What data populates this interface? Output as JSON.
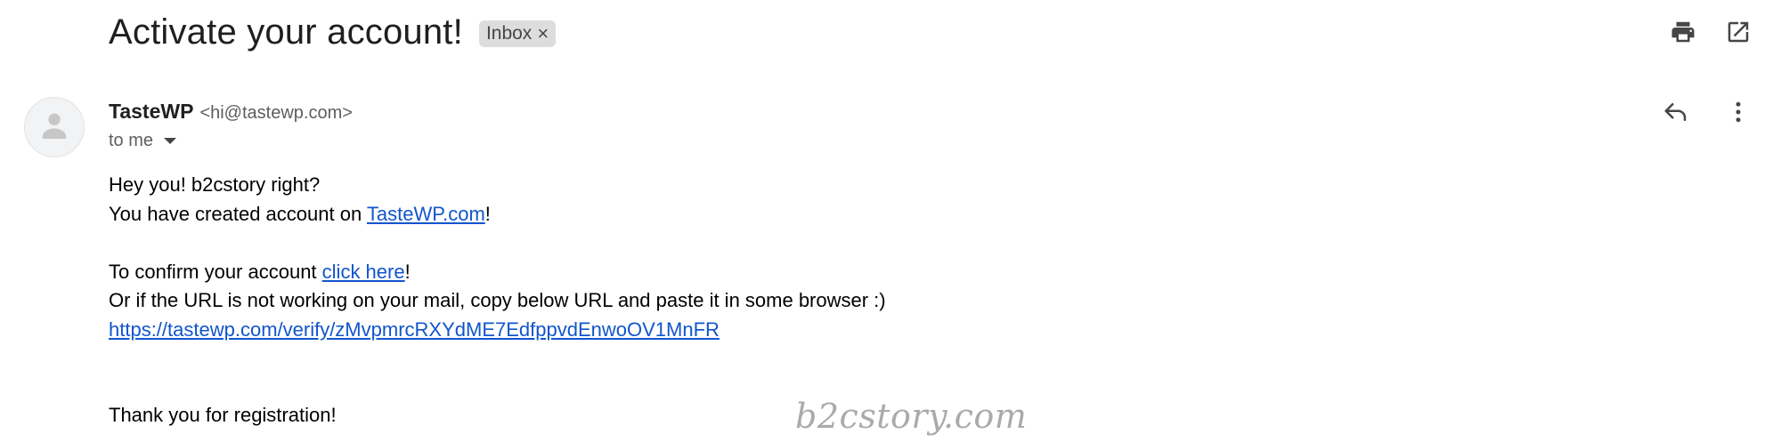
{
  "email": {
    "subject": "Activate your account!",
    "label": "Inbox",
    "label_remove": "×",
    "sender_name": "TasteWP",
    "sender_email": "<hi@tastewp.com>",
    "recipient": "to me"
  },
  "toolbar": {
    "print_icon": "print-icon",
    "popout_icon": "open-in-new-window-icon",
    "reply_icon": "reply-icon",
    "more_icon": "more-vertical-icon"
  },
  "message": {
    "greeting": "Hey you! b2cstory right?",
    "created_prefix": "You have created account on ",
    "created_link": "TasteWP.com",
    "created_suffix": "!",
    "confirm_prefix": "To confirm your account ",
    "confirm_link": "click here",
    "confirm_suffix": "!",
    "fallback_text": "Or if the URL is not working on your mail, copy below URL and paste it in some browser :)",
    "verify_url": "https://tastewp.com/verify/zMvpmrcRXYdME7EdfppvdEnwoOV1MnFR",
    "closing": "Thank you for registration!"
  },
  "watermark": "b2cstory.com",
  "colors": {
    "link": "#1155cc",
    "chip_bg": "#dddddd",
    "icon": "#444746",
    "avatar_bg": "#f1f3f4"
  }
}
